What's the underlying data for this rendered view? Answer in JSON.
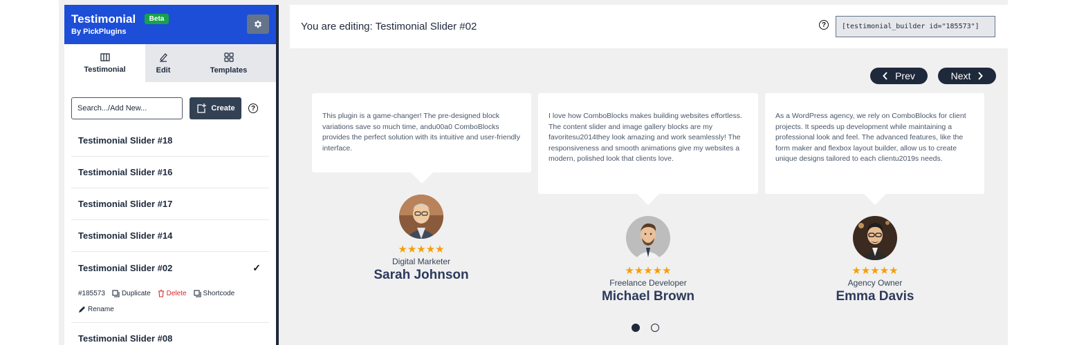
{
  "sidebar": {
    "brand_title": "Testimonial",
    "beta_label": "Beta",
    "brand_sub": "By PickPlugins",
    "tabs": [
      {
        "label": "Testimonial",
        "icon": "columns-icon"
      },
      {
        "label": "Edit",
        "icon": "pencil-icon"
      },
      {
        "label": "Templates",
        "icon": "grid-icon"
      }
    ],
    "search_placeholder": "Search.../Add New...",
    "create_label": "Create",
    "help_symbol": "?",
    "items": [
      {
        "label": "Testimonial Slider #18"
      },
      {
        "label": "Testimonial Slider #16"
      },
      {
        "label": "Testimonial Slider #17"
      },
      {
        "label": "Testimonial Slider #14"
      },
      {
        "label": "Testimonial Slider #02",
        "selected": true
      },
      {
        "label": "Testimonial Slider #08"
      }
    ],
    "selected_check": "✓",
    "actions": {
      "id": "#185573",
      "duplicate": "Duplicate",
      "delete": "Delete",
      "shortcode": "Shortcode",
      "rename": "Rename"
    }
  },
  "header": {
    "editing": "You are editing: Testimonial Slider #02",
    "help_symbol": "?",
    "shortcode": "[testimonial_builder id=\"185573\"]"
  },
  "slider": {
    "prev_label": "Prev",
    "next_label": "Next",
    "cards": [
      {
        "text": "This plugin is a game-changer! The pre-designed block variations save so much time, andu00a0 ComboBlocks provides the perfect solution with its intuitive and user-friendly interface.",
        "stars": "★★★★★",
        "role": "Digital Marketer",
        "name": "Sarah Johnson"
      },
      {
        "text": "I love how ComboBlocks makes building websites effortless. The content slider and image gallery blocks are my favoritesu2014they look amazing and work seamlessly! The responsiveness and smooth animations give my websites a modern, polished look that clients love.",
        "stars": "★★★★★",
        "role": "Freelance Developer",
        "name": "Michael Brown"
      },
      {
        "text": "As a WordPress agency, we rely on ComboBlocks for client projects. It speeds up development while maintaining a professional look and feel. The advanced features, like the form maker and flexbox layout builder, allow us to create unique designs tailored to each clientu2019s needs.",
        "stars": "★★★★★",
        "role": "Agency Owner",
        "name": "Emma Davis"
      }
    ],
    "star_color": "#f59e0b"
  },
  "colors": {
    "brand": "#1d4ed8",
    "dark": "#1e293b",
    "delete": "#dc2626",
    "beta": "#16a34a"
  }
}
